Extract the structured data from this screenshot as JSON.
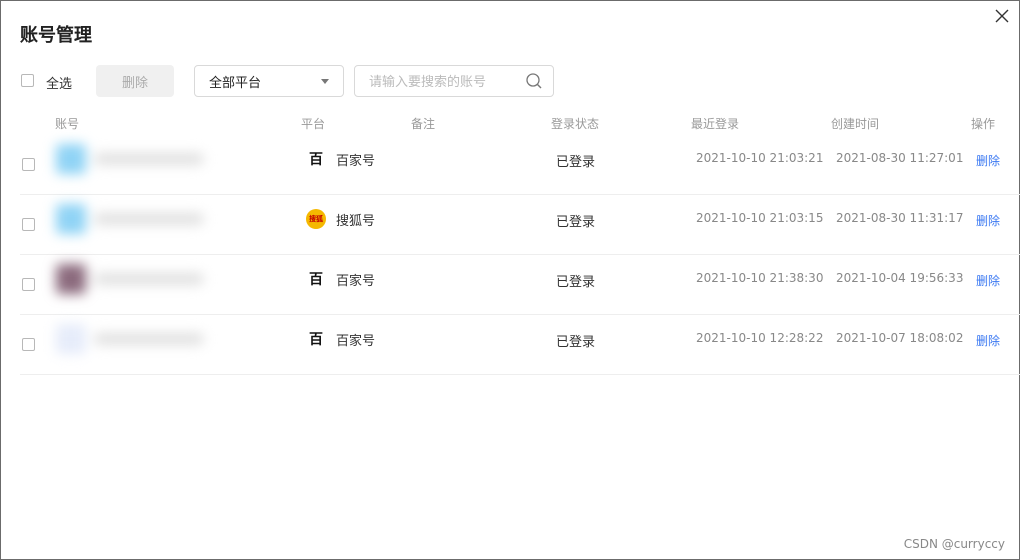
{
  "dialog": {
    "title": "账号管理"
  },
  "toolbar": {
    "select_all_label": "全选",
    "delete_label": "删除",
    "platform_select_value": "全部平台",
    "search_placeholder": "请输入要搜索的账号"
  },
  "table": {
    "headers": [
      "账号",
      "平台",
      "备注",
      "登录状态",
      "最近登录",
      "创建时间",
      "操作"
    ],
    "rows": [
      {
        "platform": "百家号",
        "platform_icon": "baijiahao-icon",
        "status": "已登录",
        "last_login": "2021-10-10 21:03:21",
        "created": "2021-08-30 11:27:01",
        "action": "删除",
        "avatar_color": "#8fd3f5"
      },
      {
        "platform": "搜狐号",
        "platform_icon": "sohu-icon",
        "status": "已登录",
        "last_login": "2021-10-10 21:03:15",
        "created": "2021-08-30 11:31:17",
        "action": "删除",
        "avatar_color": "#8fd3f5"
      },
      {
        "platform": "百家号",
        "platform_icon": "baijiahao-icon",
        "status": "已登录",
        "last_login": "2021-10-10 21:38:30",
        "created": "2021-10-04 19:56:33",
        "action": "删除",
        "avatar_color": "#8b6a7d"
      },
      {
        "platform": "百家号",
        "platform_icon": "baijiahao-icon",
        "status": "已登录",
        "last_login": "2021-10-10 12:28:22",
        "created": "2021-10-07 18:08:02",
        "action": "删除",
        "avatar_color": "#e6ecfa"
      }
    ]
  },
  "icons": {
    "baijiahao_glyph": "百",
    "sohu_glyph": "搜狐"
  },
  "colors": {
    "link": "#3a78f2"
  },
  "watermark": "CSDN @curryccy"
}
